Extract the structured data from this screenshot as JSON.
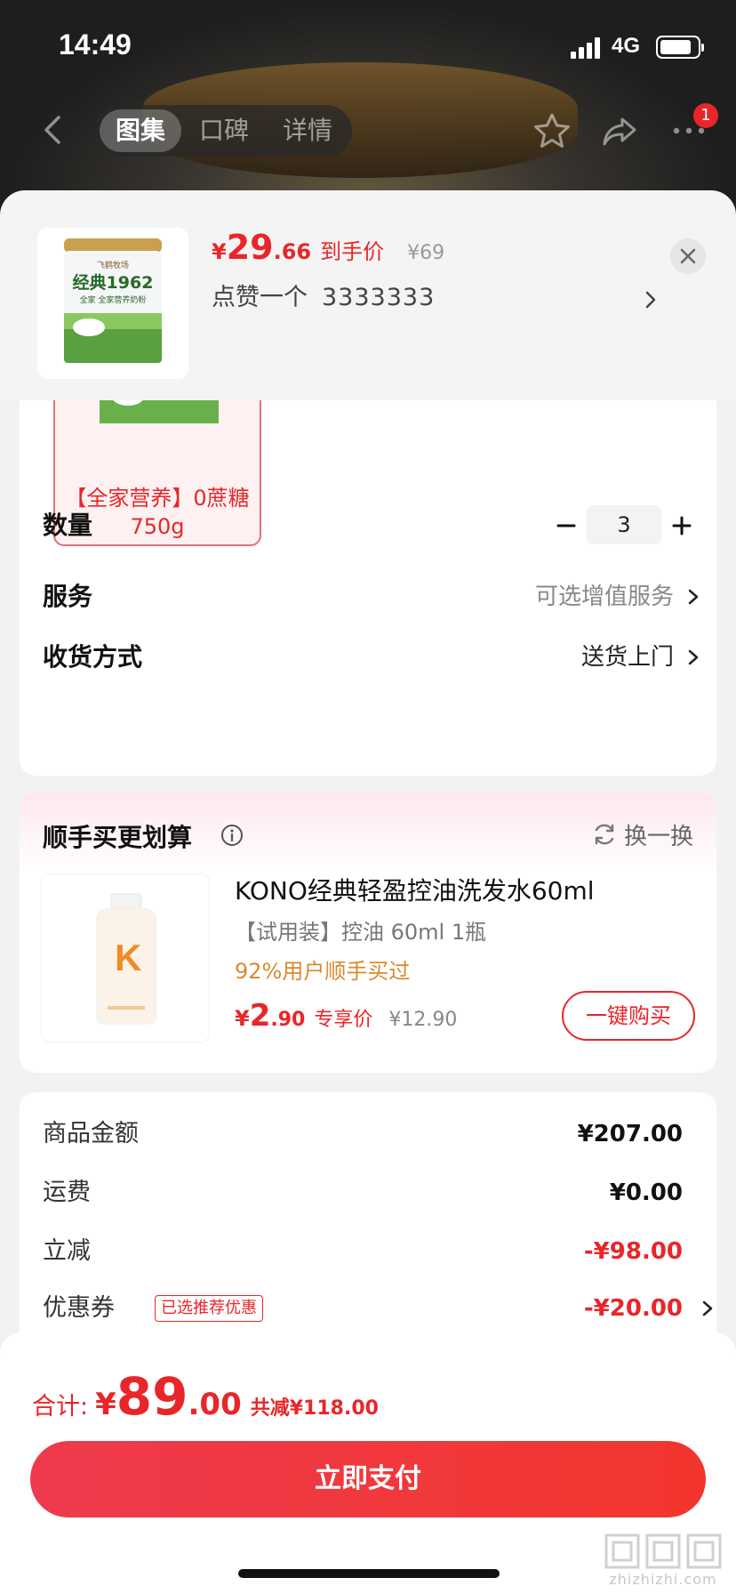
{
  "status_bar": {
    "time": "14:49",
    "network": "4G"
  },
  "nav": {
    "tabs": [
      {
        "label": "图集",
        "active": true
      },
      {
        "label": "口碑",
        "active": false
      },
      {
        "label": "详情",
        "active": false
      }
    ],
    "more_badge": "1"
  },
  "product_header": {
    "price_currency": "¥",
    "price_int": "29",
    "price_dec": ".66",
    "price_tag": "到手价",
    "original_price": "¥69",
    "spec_label": "点赞一个",
    "spec_value": "3333333",
    "thumb_brand": "飞鹤牧场",
    "thumb_title": "经典1962",
    "thumb_sub": "全家 全家营养奶粉"
  },
  "variant": {
    "label": "【全家营养】0蔗糖 750g"
  },
  "options": {
    "quantity_label": "数量",
    "quantity_value": "3",
    "service_label": "服务",
    "service_value": "可选增值服务",
    "delivery_label": "收货方式",
    "delivery_value": "送货上门"
  },
  "recommend": {
    "title": "顺手买更划算",
    "swap_label": "换一换",
    "product_name": "KONO经典轻盈控油洗发水60ml",
    "product_sub": "【试用装】控油 60ml 1瓶",
    "product_stat": "92%用户顺手买过",
    "price_currency": "¥",
    "price_int": "2",
    "price_dec": ".90",
    "price_tag": "专享价",
    "original_price": "¥12.90",
    "buy_label": "一键购买",
    "bottle_letter": "K"
  },
  "summary": {
    "rows": [
      {
        "label": "商品金额",
        "value": "¥207.00"
      },
      {
        "label": "运费",
        "value": "¥0.00"
      },
      {
        "label": "立减",
        "value": "-¥98.00"
      },
      {
        "label": "优惠券",
        "value": "-¥20.00",
        "tag": "已选推荐优惠"
      }
    ]
  },
  "footer": {
    "total_label": "合计:",
    "total_currency": "¥",
    "total_int": "89",
    "total_dec": ".00",
    "total_save": "共减¥118.00",
    "pay_label": "立即支付",
    "watermark": "zhizhizhi.com"
  },
  "colors": {
    "accent": "#e8262a",
    "pay_gradient_start": "#ef3a4e",
    "pay_gradient_end": "#f2362d"
  }
}
